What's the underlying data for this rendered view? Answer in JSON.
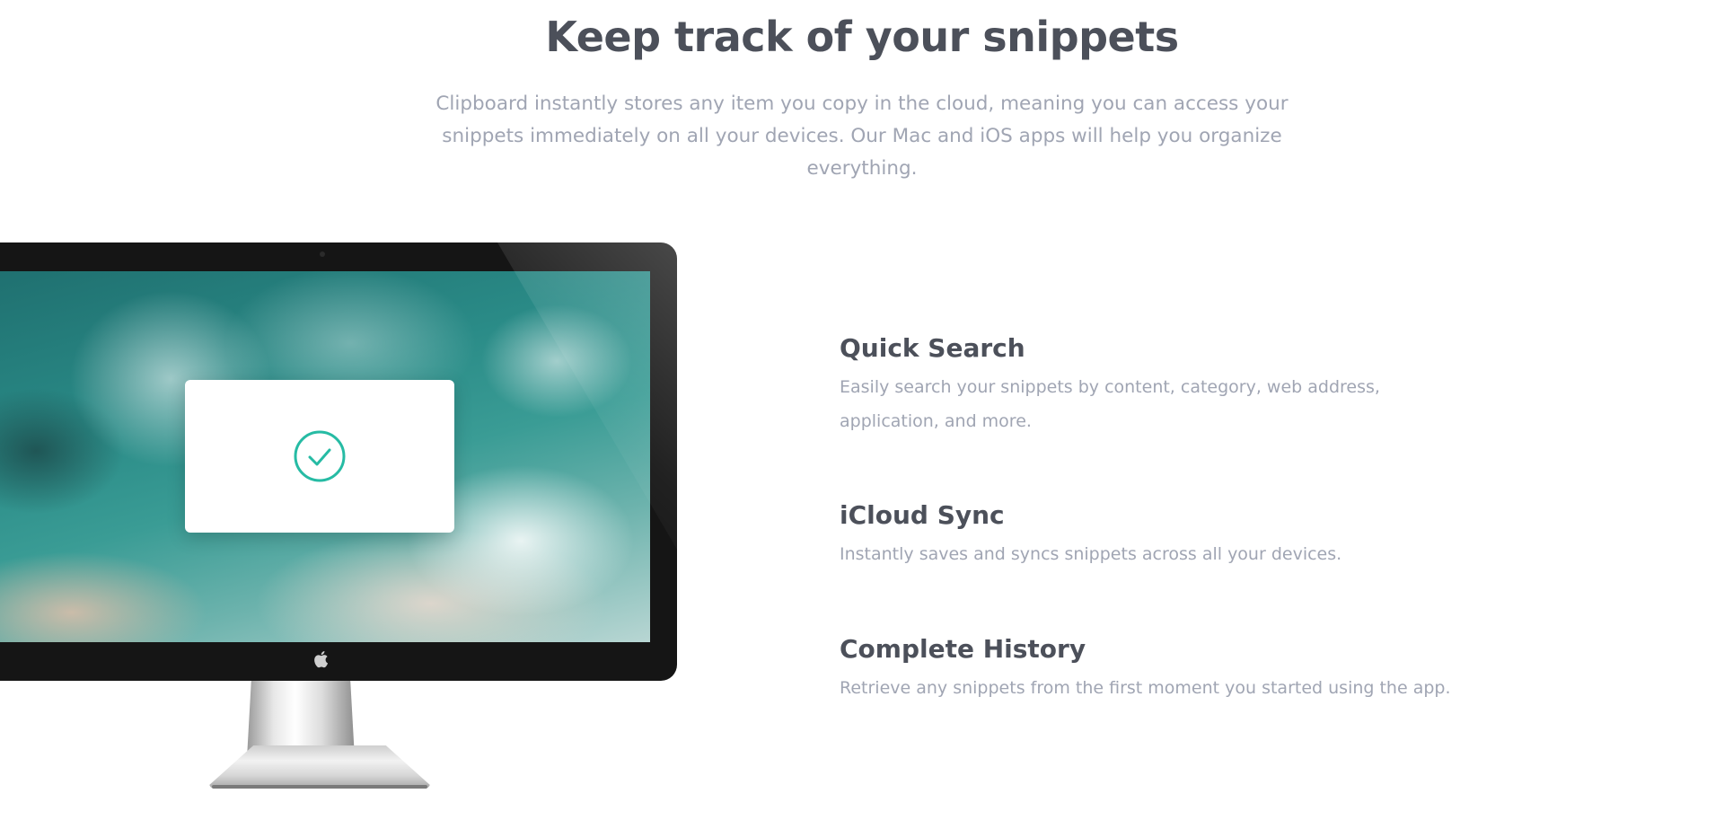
{
  "header": {
    "title": "Keep track of your snippets",
    "subtitle": "Clipboard instantly stores any item you copy in the cloud, meaning you can access your snippets immediately on all your devices. Our Mac and iOS apps will help you organize everything."
  },
  "illustration": {
    "device": "desktop-monitor",
    "dialog_icon": "check-circle-icon",
    "logo_icon": "apple-icon",
    "logo_glyph": "",
    "accent_color": "#26bba4"
  },
  "features": [
    {
      "title": "Quick Search",
      "description": "Easily search your snippets by content, category, web address, application, and more."
    },
    {
      "title": "iCloud Sync",
      "description": "Instantly saves and syncs snippets across all your devices."
    },
    {
      "title": "Complete History",
      "description": "Retrieve any snippets from the first moment you started using the app."
    }
  ],
  "colors": {
    "heading": "#4c505a",
    "body_text": "#a0a5b3",
    "background": "#ffffff"
  }
}
